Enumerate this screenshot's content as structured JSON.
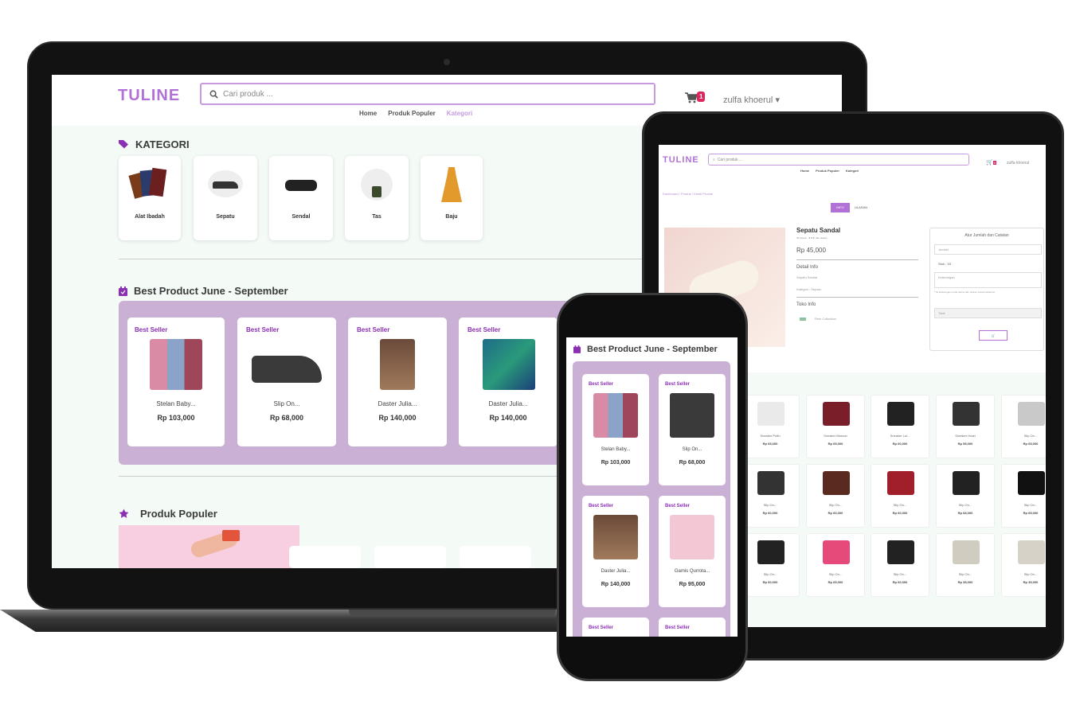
{
  "laptop": {
    "brand": "TULINE",
    "search_placeholder": "Cari produk ...",
    "cart_count": "1",
    "user_name": "zulfa khoerul",
    "nav": [
      "Home",
      "Produk Populer",
      "Kategori"
    ],
    "kategori_title": "KATEGORI",
    "categories": [
      "Alat Ibadah",
      "Sepatu",
      "Sendal",
      "Tas",
      "Baju"
    ],
    "best_title": "Best Product June - September",
    "best_products": [
      {
        "badge": "Best Seller",
        "name": "Stelan Baby...",
        "price": "Rp 103,000"
      },
      {
        "badge": "Best Seller",
        "name": "Slip On...",
        "price": "Rp 68,000"
      },
      {
        "badge": "Best Seller",
        "name": "Daster Julia...",
        "price": "Rp 140,000"
      },
      {
        "badge": "Best Seller",
        "name": "Daster Julia...",
        "price": "Rp 140,000"
      }
    ],
    "populer_title": "Produk Populer"
  },
  "tablet": {
    "brand": "TULINE",
    "search_placeholder": "Cari produk ...",
    "cart_count": "0",
    "user_name": "zulfa khoerul",
    "nav": [
      "Home",
      "Produk Populer",
      "Kategori"
    ],
    "breadcrumb": "Dashboard / Produk / Detail Produk",
    "tabs": [
      "INFO",
      "ULASAN"
    ],
    "product_name": "Sepatu Sandal",
    "product_meta": "30 terjual · ★★★ dari ulasan",
    "product_price": "Rp 45,000",
    "detail_heading": "Detail Info",
    "detail_lines": [
      "Sepatu Sandal",
      "Kategori : Sepatu"
    ],
    "toko_heading": "Toko Info",
    "toko_name": "Rein Collection",
    "order_box_title": "Atur Jumlah dan Catatan",
    "qty_placeholder": "Jumlah",
    "stock": "Stok : 33",
    "note_placeholder": "Keterangan",
    "note_hint": "* Isi keterangan untuk warna dan ukuran sesuai deskripsi",
    "total_label": "Total",
    "grid_items": [
      {
        "name": "Sneaker Putih",
        "price": "Rp 65,000"
      },
      {
        "name": "Sneaker Maroon",
        "price": "Rp 65,000"
      },
      {
        "name": "Sneaker Lol...",
        "price": "Rp 60,000"
      },
      {
        "name": "Sneaker Hoari",
        "price": "Rp 55,000"
      },
      {
        "name": "Slip On...",
        "price": "Rp 65,000"
      },
      {
        "name": "Slip On...",
        "price": "Rp 60,000"
      },
      {
        "name": "Slip On...",
        "price": "Rp 60,000"
      },
      {
        "name": "Slip On...",
        "price": "Rp 60,000"
      },
      {
        "name": "Slip On...",
        "price": "Rp 68,000"
      },
      {
        "name": "Slip On...",
        "price": "Rp 65,000"
      },
      {
        "name": "Slip On...",
        "price": "Rp 60,000"
      },
      {
        "name": "Slip On...",
        "price": "Rp 65,000"
      },
      {
        "name": "Slip On...",
        "price": "Rp 60,000"
      },
      {
        "name": "Slip On...",
        "price": "Rp 35,000"
      },
      {
        "name": "Slip On...",
        "price": "Rp 35,000"
      }
    ]
  },
  "phone": {
    "best_title": "Best Product June - September",
    "products": [
      {
        "badge": "Best Seller",
        "name": "Stelan Baby...",
        "price": "Rp 103,000"
      },
      {
        "badge": "Best Seller",
        "name": "Slip On...",
        "price": "Rp 68,000"
      },
      {
        "badge": "Best Seller",
        "name": "Daster Julia...",
        "price": "Rp 140,000"
      },
      {
        "badge": "Best Seller",
        "name": "Gamis Qurrota...",
        "price": "Rp 95,000"
      },
      {
        "badge": "Best Seller",
        "name": "",
        "price": ""
      },
      {
        "badge": "Best Seller",
        "name": "",
        "price": ""
      }
    ]
  },
  "colors": {
    "brand": "#b271d6",
    "accent": "#8b2fb3",
    "panel": "#cbb0d6",
    "badge": "#e0245e"
  }
}
